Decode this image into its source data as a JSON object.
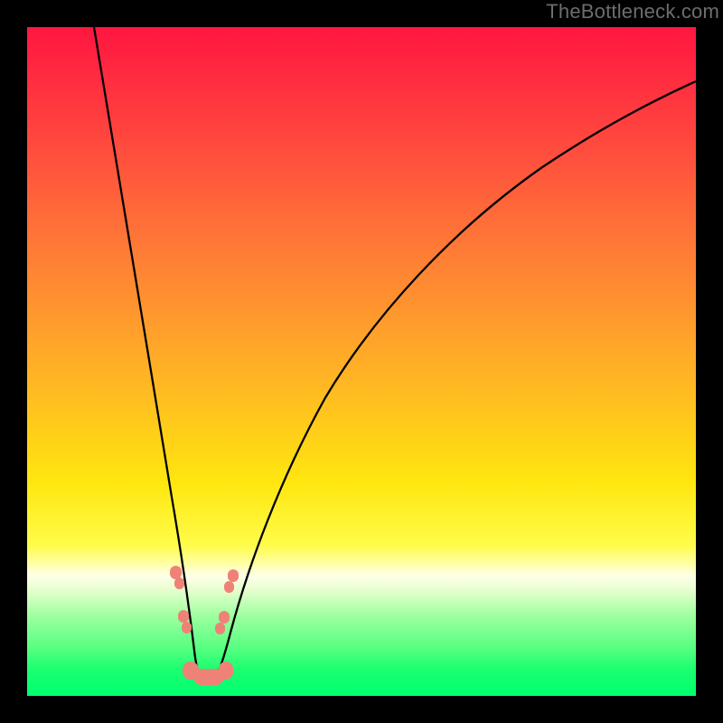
{
  "watermark": "TheBottleneck.com",
  "colors": {
    "frame": "#000000",
    "watermark": "#6d6d6d",
    "curve": "#000000",
    "marker": "#ef8277"
  },
  "chart_data": {
    "type": "line",
    "title": "",
    "xlabel": "",
    "ylabel": "",
    "xlim": [
      0,
      100
    ],
    "ylim": [
      0,
      100
    ],
    "note": "No axis ticks or numeric labels are rendered; x/y are normalized 0–100 across the plot area. y≈100 at top, y≈0 at bottom (green).",
    "series": [
      {
        "name": "bottleneck-curve",
        "x": [
          10,
          12,
          14,
          16,
          18,
          20,
          22,
          23,
          24,
          25,
          26,
          27,
          28,
          30,
          33,
          36,
          40,
          45,
          50,
          56,
          63,
          72,
          82,
          92,
          100
        ],
        "y": [
          100,
          88,
          76,
          63,
          50,
          37,
          23,
          15,
          7,
          3,
          2,
          2,
          3,
          8,
          15,
          23,
          32,
          42,
          50,
          58,
          65,
          72,
          78,
          82,
          85
        ]
      }
    ],
    "markers": [
      {
        "name": "cluster-left-upper",
        "x": 22.0,
        "y": 19,
        "size": "small-pair"
      },
      {
        "name": "cluster-left-lower",
        "x": 22.8,
        "y": 12,
        "size": "small-pair"
      },
      {
        "name": "cluster-right-upper",
        "x": 30.0,
        "y": 18,
        "size": "small-pair"
      },
      {
        "name": "cluster-right-lower",
        "x": 29.3,
        "y": 12,
        "size": "small-pair"
      },
      {
        "name": "valley-blob",
        "x": 26.0,
        "y": 4,
        "size": "wide"
      }
    ]
  }
}
